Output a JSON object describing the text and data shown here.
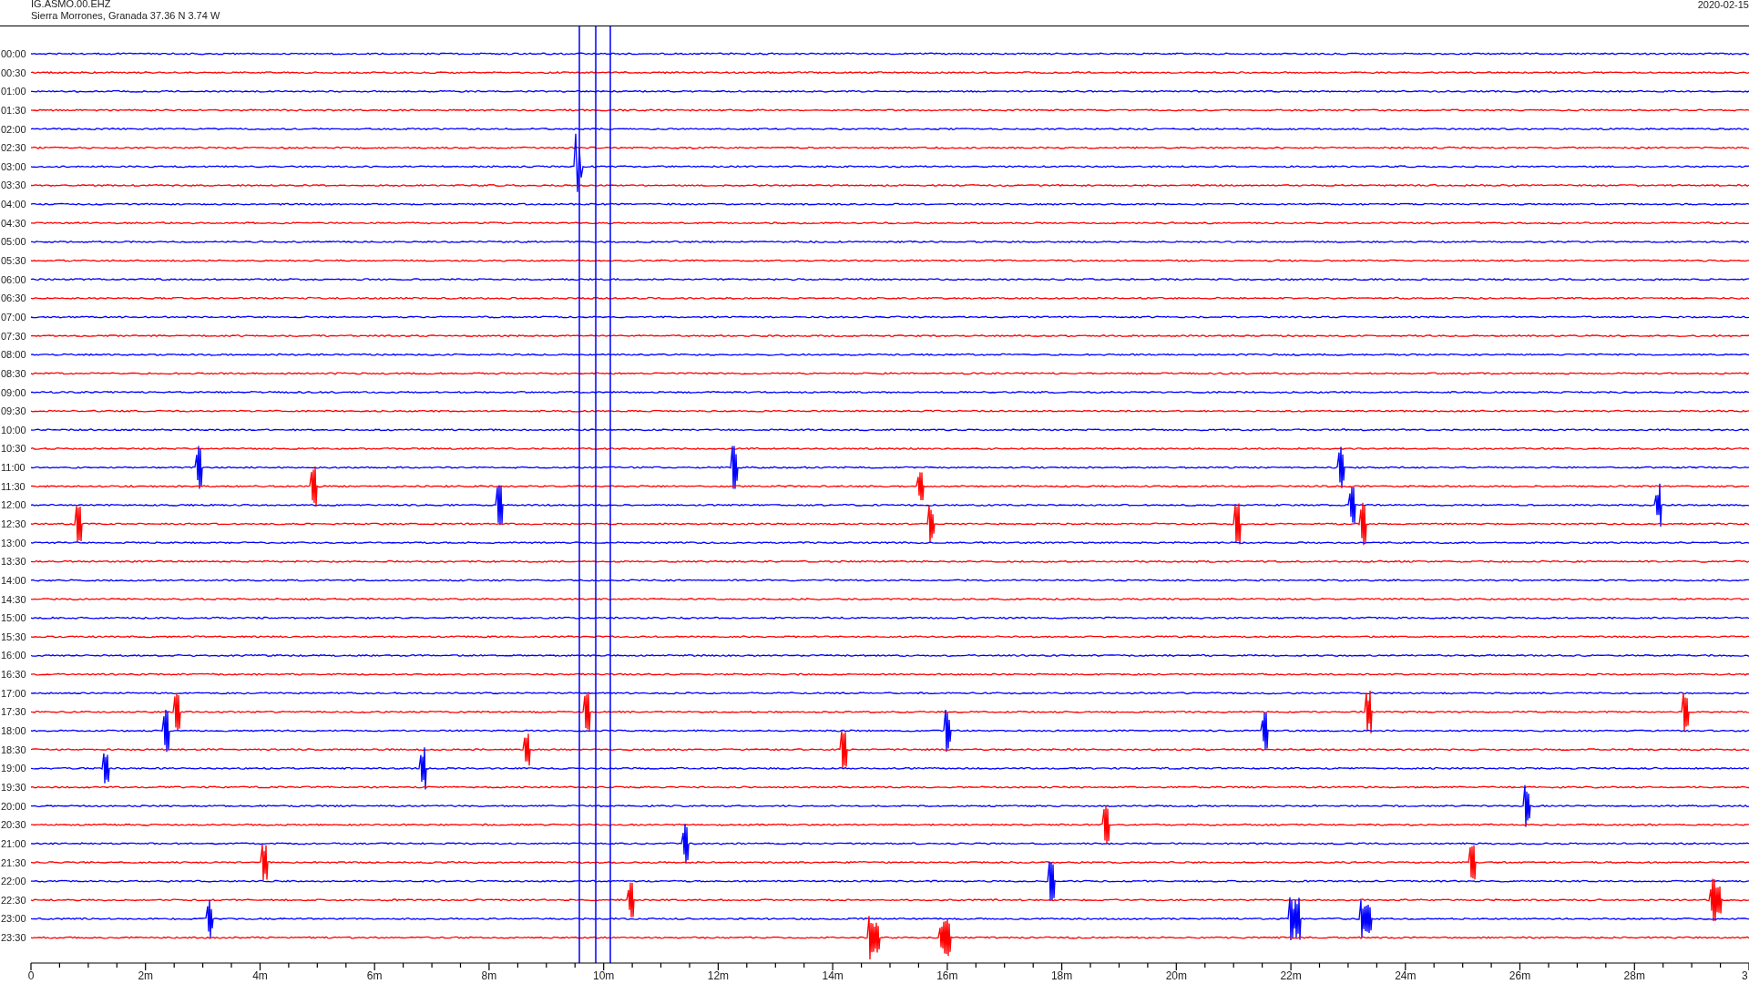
{
  "header": {
    "station": "IG.ASMO.00.EHZ",
    "location": "Sierra Morrones, Granada  37.36 N 3.74 W",
    "date": "2020-02-15"
  },
  "rows": [
    {
      "label": "00:00",
      "color": "#0000ff"
    },
    {
      "label": "00:30",
      "color": "#ff0000"
    },
    {
      "label": "01:00",
      "color": "#0000ff"
    },
    {
      "label": "01:30",
      "color": "#ff0000"
    },
    {
      "label": "02:00",
      "color": "#0000ff"
    },
    {
      "label": "02:30",
      "color": "#ff0000"
    },
    {
      "label": "03:00",
      "color": "#0000ff"
    },
    {
      "label": "03:30",
      "color": "#ff0000"
    },
    {
      "label": "04:00",
      "color": "#0000ff"
    },
    {
      "label": "04:30",
      "color": "#ff0000"
    },
    {
      "label": "05:00",
      "color": "#0000ff"
    },
    {
      "label": "05:30",
      "color": "#ff0000"
    },
    {
      "label": "06:00",
      "color": "#0000ff"
    },
    {
      "label": "06:30",
      "color": "#ff0000"
    },
    {
      "label": "07:00",
      "color": "#0000ff"
    },
    {
      "label": "07:30",
      "color": "#ff0000"
    },
    {
      "label": "08:00",
      "color": "#0000ff"
    },
    {
      "label": "08:30",
      "color": "#ff0000"
    },
    {
      "label": "09:00",
      "color": "#0000ff"
    },
    {
      "label": "09:30",
      "color": "#ff0000"
    },
    {
      "label": "10:00",
      "color": "#0000ff"
    },
    {
      "label": "10:30",
      "color": "#ff0000"
    },
    {
      "label": "11:00",
      "color": "#0000ff"
    },
    {
      "label": "11:30",
      "color": "#ff0000"
    },
    {
      "label": "12:00",
      "color": "#0000ff"
    },
    {
      "label": "12:30",
      "color": "#ff0000"
    },
    {
      "label": "13:00",
      "color": "#0000ff"
    },
    {
      "label": "13:30",
      "color": "#ff0000"
    },
    {
      "label": "14:00",
      "color": "#0000ff"
    },
    {
      "label": "14:30",
      "color": "#ff0000"
    },
    {
      "label": "15:00",
      "color": "#0000ff"
    },
    {
      "label": "15:30",
      "color": "#ff0000"
    },
    {
      "label": "16:00",
      "color": "#0000ff"
    },
    {
      "label": "16:30",
      "color": "#ff0000"
    },
    {
      "label": "17:00",
      "color": "#0000ff"
    },
    {
      "label": "17:30",
      "color": "#ff0000"
    },
    {
      "label": "18:00",
      "color": "#0000ff"
    },
    {
      "label": "18:30",
      "color": "#ff0000"
    },
    {
      "label": "19:00",
      "color": "#0000ff"
    },
    {
      "label": "19:30",
      "color": "#ff0000"
    },
    {
      "label": "20:00",
      "color": "#0000ff"
    },
    {
      "label": "20:30",
      "color": "#ff0000"
    },
    {
      "label": "21:00",
      "color": "#0000ff"
    },
    {
      "label": "21:30",
      "color": "#ff0000"
    },
    {
      "label": "22:00",
      "color": "#0000ff"
    },
    {
      "label": "22:30",
      "color": "#ff0000"
    },
    {
      "label": "23:00",
      "color": "#0000ff"
    },
    {
      "label": "23:30",
      "color": "#ff0000"
    }
  ],
  "x_axis": {
    "ticks": [
      "0",
      "2m",
      "4m",
      "6m",
      "8m",
      "10m",
      "12m",
      "14m",
      "16m",
      "18m",
      "20m",
      "22m",
      "24m",
      "26m",
      "28m",
      "3"
    ]
  }
}
